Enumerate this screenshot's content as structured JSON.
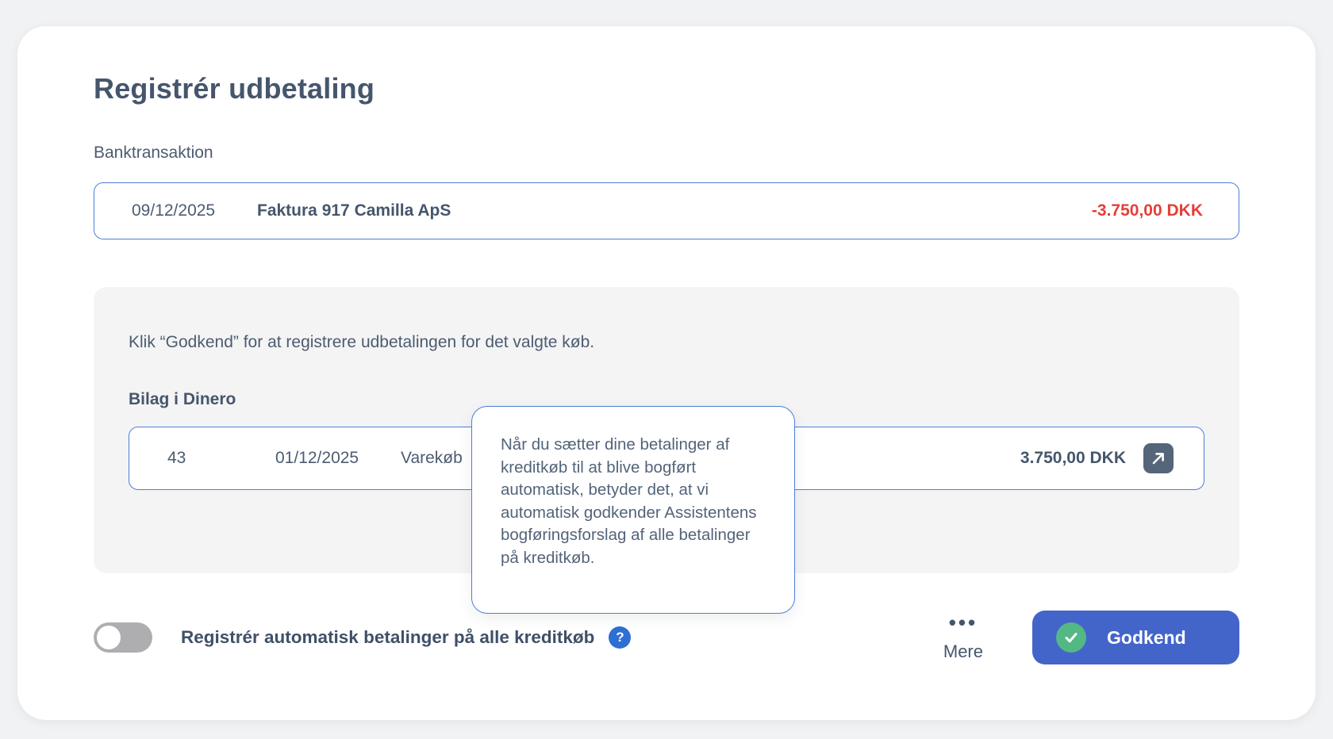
{
  "page": {
    "title": "Registrér udbetaling"
  },
  "bank_transaction": {
    "section_label": "Banktransaktion",
    "date": "09/12/2025",
    "description": "Faktura 917 Camilla ApS",
    "amount": "-3.750,00 DKK",
    "amount_color": "#e63e38"
  },
  "panel": {
    "instruction": "Klik “Godkend” for at registrere udbetalingen for det valgte køb.",
    "bilag_section_label": "Bilag i Dinero",
    "bilag": {
      "number": "43",
      "date": "01/12/2025",
      "description": "Varekøb",
      "amount": "3.750,00 DKK",
      "link_icon": "external-link-icon"
    }
  },
  "tooltip": {
    "text": "Når du sætter dine betalinger af kreditkøb til at blive bogført automatisk, betyder det, at vi automatisk godkender Assistentens bogføringsforslag af alle betalinger på kreditkøb."
  },
  "footer": {
    "toggle_label": "Registrér automatisk betalinger på alle kreditkøb",
    "toggle_state": "off",
    "help_glyph": "?",
    "more": {
      "dots": "•••",
      "label": "Mere"
    },
    "approve_button": {
      "label": "Godkend",
      "color": "#4365ca",
      "check_color": "#54b884"
    }
  },
  "colors": {
    "accent_blue_border": "#4e7ed8",
    "text_slate": "#45566c",
    "panel_gray": "#f4f4f5",
    "negative_red": "#e63e38"
  }
}
